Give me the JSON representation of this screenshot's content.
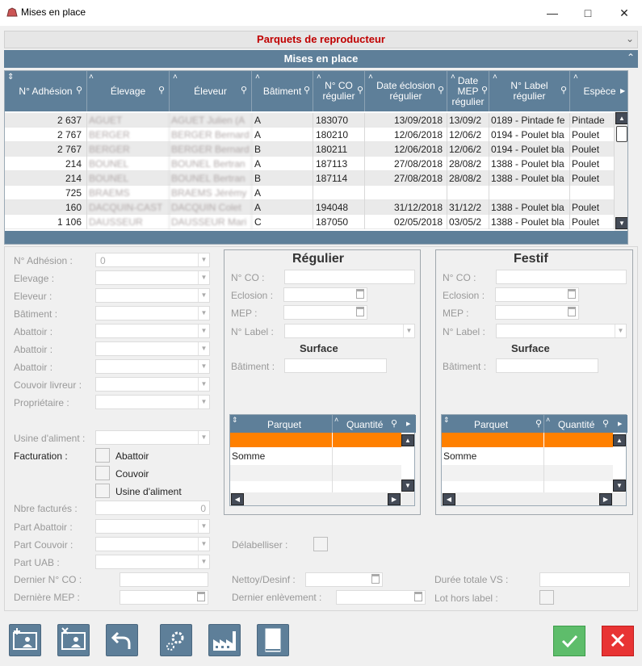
{
  "window": {
    "title": "Mises en place"
  },
  "sections": {
    "parquets": "Parquets de reproducteur",
    "mises": "Mises en place"
  },
  "grid": {
    "columns": [
      "N° Adhésion",
      "Élevage",
      "Éleveur",
      "Bâtiment",
      "N° CO régulier",
      "Date éclosion régulier",
      "Date MEP régulier",
      "N° Label régulier",
      "Espèce"
    ],
    "rows": [
      {
        "adh": "2 637",
        "elev": "AGUET",
        "eleveur": "AGUET Julien (A",
        "bat": "A",
        "co": "183070",
        "ecl": "13/09/2018",
        "mep": "13/09/2",
        "label": "0189 - Pintade fe",
        "esp": "Pintade"
      },
      {
        "adh": "2 767",
        "elev": "BERGER",
        "eleveur": "BERGER Bernard",
        "bat": "A",
        "co": "180210",
        "ecl": "12/06/2018",
        "mep": "12/06/2",
        "label": "0194 - Poulet bla",
        "esp": "Poulet"
      },
      {
        "adh": "2 767",
        "elev": "BERGER",
        "eleveur": "BERGER Bernard",
        "bat": "B",
        "co": "180211",
        "ecl": "12/06/2018",
        "mep": "12/06/2",
        "label": "0194 - Poulet bla",
        "esp": "Poulet"
      },
      {
        "adh": "214",
        "elev": "BOUNEL",
        "eleveur": "BOUNEL Bertran",
        "bat": "A",
        "co": "187113",
        "ecl": "27/08/2018",
        "mep": "28/08/2",
        "label": "1388 - Poulet bla",
        "esp": "Poulet"
      },
      {
        "adh": "214",
        "elev": "BOUNEL",
        "eleveur": "BOUNEL Bertran",
        "bat": "B",
        "co": "187114",
        "ecl": "27/08/2018",
        "mep": "28/08/2",
        "label": "1388 - Poulet bla",
        "esp": "Poulet"
      },
      {
        "adh": "725",
        "elev": "BRAEMS",
        "eleveur": "BRAEMS Jérémy",
        "bat": "A",
        "co": "",
        "ecl": "",
        "mep": "",
        "label": "",
        "esp": ""
      },
      {
        "adh": "160",
        "elev": "DACQUIN-CAST",
        "eleveur": "DACQUIN Colet",
        "bat": "A",
        "co": "194048",
        "ecl": "31/12/2018",
        "mep": "31/12/2",
        "label": "1388 - Poulet bla",
        "esp": "Poulet"
      },
      {
        "adh": "1 106",
        "elev": "DAUSSEUR",
        "eleveur": "DAUSSEUR Mari",
        "bat": "C",
        "co": "187050",
        "ecl": "02/05/2018",
        "mep": "03/05/2",
        "label": "1388 - Poulet bla",
        "esp": "Poulet"
      }
    ]
  },
  "form": {
    "labels": {
      "adhesion": "N° Adhésion :",
      "elevage": "Elevage :",
      "eleveur": "Eleveur :",
      "batiment": "Bâtiment :",
      "abattoir": "Abattoir :",
      "couvoir": "Couvoir livreur :",
      "proprietaire": "Propriétaire :",
      "usine": "Usine d'aliment :",
      "facturation": "Facturation :",
      "nbre": "Nbre facturés :",
      "part_abattoir": "Part Abattoir :",
      "part_couvoir": "Part Couvoir :",
      "part_uab": "Part UAB :",
      "dernier_co": "Dernier N° CO :",
      "derniere_mep": "Dernière MEP :"
    },
    "adhesion_value": "0",
    "nbre_value": "0",
    "checks": {
      "abattoir": "Abattoir",
      "couvoir": "Couvoir",
      "usine": "Usine d'aliment"
    }
  },
  "regulier": {
    "title": "Régulier",
    "labels": {
      "co": "N° CO :",
      "eclosion": "Eclosion :",
      "mep": "MEP :",
      "label": "N° Label :",
      "surface": "Surface",
      "batiment": "Bâtiment :"
    },
    "table": {
      "parquet": "Parquet",
      "quantite": "Quantité",
      "somme": "Somme"
    }
  },
  "festif": {
    "title": "Festif",
    "labels": {
      "co": "N° CO :",
      "eclosion": "Eclosion :",
      "mep": "MEP :",
      "label": "N° Label :",
      "surface": "Surface",
      "batiment": "Bâtiment :"
    },
    "table": {
      "parquet": "Parquet",
      "quantite": "Quantité",
      "somme": "Somme"
    }
  },
  "bottom": {
    "delabelliser": "Délabelliser :",
    "nettoy": "Nettoy/Desinf :",
    "dernier_enl": "Dernier enlèvement :",
    "duree": "Durée totale VS :",
    "lot": "Lot hors label :"
  },
  "colors": {
    "header": "#5e7f99",
    "accent_red": "#c00000",
    "orange": "#ff8000",
    "ok": "#5ebd6b",
    "cancel": "#e83434"
  }
}
